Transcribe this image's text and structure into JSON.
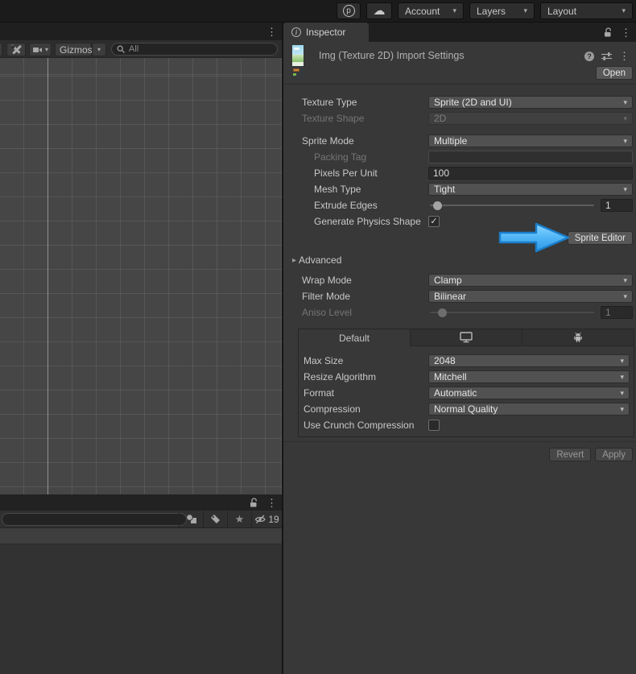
{
  "topbar": {
    "account": "Account",
    "layers": "Layers",
    "layout": "Layout"
  },
  "icons": {
    "kebab": "⋮",
    "dropdown_arrow": "▾",
    "star": "★",
    "check": "✓",
    "info": "i",
    "help": "?",
    "foldout_collapsed": "▸",
    "cloud": "☁",
    "plastic_p": "p"
  },
  "scene": {
    "gizmos": "Gizmos",
    "search_placeholder": "All"
  },
  "project": {
    "hidden_count": "19"
  },
  "inspector": {
    "tab": "Inspector",
    "title": "Img (Texture 2D) Import Settings",
    "open": "Open",
    "texture_type": {
      "label": "Texture Type",
      "value": "Sprite (2D and UI)"
    },
    "texture_shape": {
      "label": "Texture Shape",
      "value": "2D"
    },
    "sprite_mode": {
      "label": "Sprite Mode",
      "value": "Multiple"
    },
    "packing_tag": {
      "label": "Packing Tag",
      "value": ""
    },
    "pixels_per_unit": {
      "label": "Pixels Per Unit",
      "value": "100"
    },
    "mesh_type": {
      "label": "Mesh Type",
      "value": "Tight"
    },
    "extrude_edges": {
      "label": "Extrude Edges",
      "value": "1"
    },
    "generate_physics_shape": {
      "label": "Generate Physics Shape",
      "checked": true
    },
    "sprite_editor": "Sprite Editor",
    "advanced": "Advanced",
    "wrap_mode": {
      "label": "Wrap Mode",
      "value": "Clamp"
    },
    "filter_mode": {
      "label": "Filter Mode",
      "value": "Bilinear"
    },
    "aniso_level": {
      "label": "Aniso Level",
      "value": "1"
    },
    "platform": {
      "default_tab": "Default",
      "max_size": {
        "label": "Max Size",
        "value": "2048"
      },
      "resize_algorithm": {
        "label": "Resize Algorithm",
        "value": "Mitchell"
      },
      "format": {
        "label": "Format",
        "value": "Automatic"
      },
      "compression": {
        "label": "Compression",
        "value": "Normal Quality"
      },
      "use_crunch": {
        "label": "Use Crunch Compression",
        "checked": false
      }
    },
    "revert": "Revert",
    "apply": "Apply"
  },
  "colors": {
    "arrow_blue": "#3ea6f2",
    "arrow_blue_light": "#8ed8ff",
    "arrow_border": "#1a7ecb",
    "panel_bg": "#383838"
  }
}
